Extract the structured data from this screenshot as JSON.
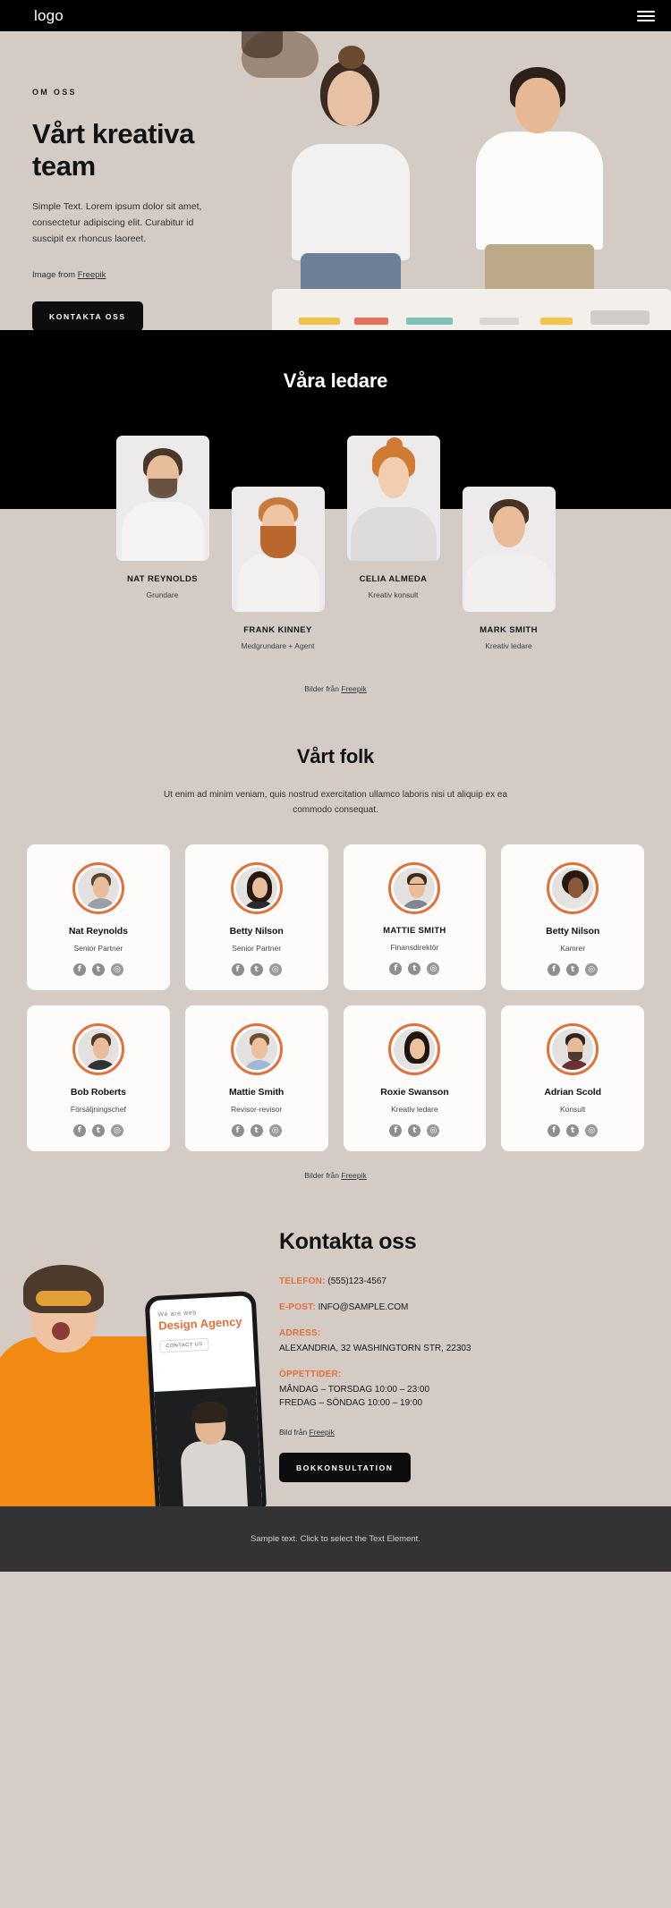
{
  "header": {
    "logo": "logo",
    "menu_icon": "hamburger-icon"
  },
  "hero": {
    "eyebrow": "OM OSS",
    "title": "Vårt kreativa team",
    "paragraph": "Simple Text. Lorem ipsum dolor sit amet, consectetur adipiscing elit. Curabitur id suscipit ex rhoncus laoreet.",
    "credit_prefix": "Image from ",
    "credit_link": "Freepik",
    "cta": "KONTAKTA OSS"
  },
  "leaders": {
    "title": "Våra ledare",
    "credit_prefix": "Bilder från ",
    "credit_link": "Freepik",
    "items": [
      {
        "name": "NAT REYNOLDS",
        "role": "Grundare"
      },
      {
        "name": "FRANK KINNEY",
        "role": "Medgrundare + Agent"
      },
      {
        "name": "CELIA ALMEDA",
        "role": "Kreativ konsult"
      },
      {
        "name": "MARK SMITH",
        "role": "Kreativ ledare"
      }
    ]
  },
  "people": {
    "title": "Vårt folk",
    "subtitle": "Ut enim ad minim veniam, quis nostrud exercitation ullamco laboris nisi ut aliquip ex ea commodo consequat.",
    "credit_prefix": "Bilder från ",
    "credit_link": "Freepik",
    "social_labels": [
      "facebook-icon",
      "twitter-icon",
      "instagram-icon"
    ],
    "accent_color": "#e2703a",
    "cards": [
      {
        "name": "Nat Reynolds",
        "role": "Senior Partner"
      },
      {
        "name": "Betty Nilson",
        "role": "Senior Partner"
      },
      {
        "name": "MATTIE SMITH",
        "role": "Finansdirektör"
      },
      {
        "name": "Betty Nilson",
        "role": "Kamrer"
      },
      {
        "name": "Bob Roberts",
        "role": "Försäljningschef"
      },
      {
        "name": "Mattie Smith",
        "role": "Revisor-revisor"
      },
      {
        "name": "Roxie Swanson",
        "role": "Kreativ ledare"
      },
      {
        "name": "Adrian Scold",
        "role": "Konsult"
      }
    ]
  },
  "contact": {
    "title": "Kontakta oss",
    "phone_label": "TELEFON:",
    "phone_value": "(555)123-4567",
    "email_label": "E-POST:",
    "email_value": "INFO@SAMPLE.COM",
    "address_label": "ADRESS:",
    "address_value": "ALEXANDRIA, 32 WASHINGTORN STR, 22303",
    "hours_label": "ÖPPETTIDER:",
    "hours_line1": "MÅNDAG – TORSDAG 10:00 – 23:00",
    "hours_line2": "FREDAG – SÖNDAG 10:00 – 19:00",
    "credit_prefix": "Bild från ",
    "credit_link": "Freepik",
    "cta": "BOKKONSULTATION",
    "phone_mock": {
      "kicker": "We are web",
      "title": "Design Agency",
      "button": "CONTACT US"
    }
  },
  "footer": {
    "text": "Sample text. Click to select the Text Element."
  }
}
